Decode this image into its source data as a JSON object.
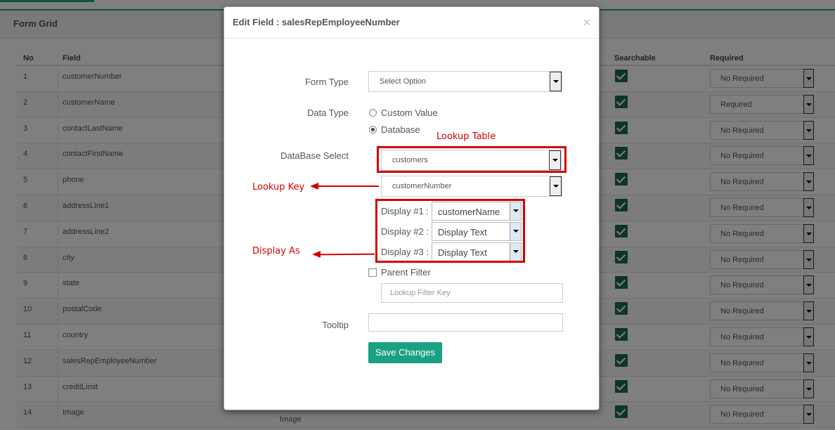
{
  "background": {
    "grid_title": "Form Grid",
    "columns": [
      "No",
      "Field",
      "Searchable",
      "Required"
    ],
    "rows": [
      {
        "no": "1",
        "field": "customerNumber",
        "required": "No Required"
      },
      {
        "no": "2",
        "field": "customerName",
        "required": "Required"
      },
      {
        "no": "3",
        "field": "contactLastName",
        "required": "No Required"
      },
      {
        "no": "4",
        "field": "contactFirstName",
        "required": "No Required"
      },
      {
        "no": "5",
        "field": "phone",
        "required": "No Required"
      },
      {
        "no": "6",
        "field": "addressLine1",
        "required": "No Required"
      },
      {
        "no": "7",
        "field": "addressLine2",
        "required": "No Required"
      },
      {
        "no": "8",
        "field": "city",
        "required": "No Required"
      },
      {
        "no": "9",
        "field": "state",
        "required": "No Required"
      },
      {
        "no": "10",
        "field": "postalCode",
        "required": "No Required"
      },
      {
        "no": "11",
        "field": "country",
        "required": "No Required"
      },
      {
        "no": "12",
        "field": "salesRepEmployeeNumber",
        "required": "No Required"
      },
      {
        "no": "13",
        "field": "creditLimit",
        "required": "No Required"
      },
      {
        "no": "14",
        "field": "Image",
        "required": "No Required",
        "label": "Image"
      }
    ]
  },
  "modal": {
    "title": "Edit Field : salesRepEmployeeNumber",
    "close": "×",
    "form_type_label": "Form Type",
    "form_type_value": "Select Option",
    "data_type_label": "Data Type",
    "data_type_options": [
      "Custom Value",
      "Database"
    ],
    "data_type_selected": "Database",
    "database_select_label": "DataBase Select",
    "database_table": "customers",
    "lookup_key": "customerNumber",
    "display": [
      {
        "label": "Display #1 :",
        "value": "customerName"
      },
      {
        "label": "Display #2 :",
        "value": "Display Text"
      },
      {
        "label": "Display #3 :",
        "value": "Display Text"
      }
    ],
    "parent_filter_label": "Parent Filter",
    "lookup_filter_placeholder": "Lookup Filter Key",
    "tooltip_label": "Tooltip",
    "tooltip_value": "",
    "save_label": "Save Changes"
  },
  "annotations": {
    "lookup_table": "Lookup Table",
    "lookup_key": "Lookup Key",
    "display_as": "Display As",
    "color": "#d40000"
  }
}
